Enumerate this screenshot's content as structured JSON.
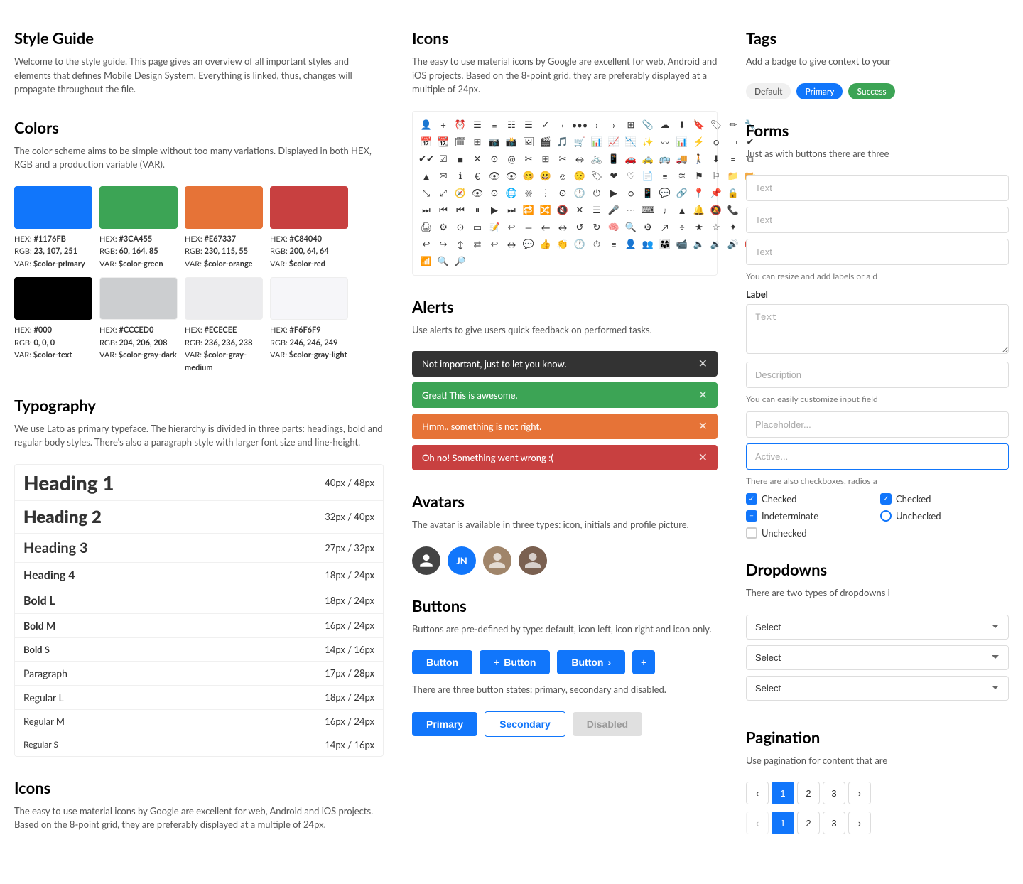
{
  "left": {
    "style_guide": {
      "title": "Style Guide",
      "desc": "Welcome to the style guide. This page gives an overview of all important styles and elements that defines Mobile Design System. Everything is linked, thus, changes will propagate throughout the file."
    },
    "colors": {
      "title": "Colors",
      "desc": "The color scheme aims to be simple without too many variations. Displayed in both HEX, RGB and a production variable (VAR).",
      "swatches": [
        {
          "hex": "#1176FB",
          "rgb": "23, 107, 251",
          "var": "$color-primary",
          "bg": "#1176FB"
        },
        {
          "hex": "#3CA455",
          "rgb": "60, 164, 85",
          "var": "$color-green",
          "bg": "#3CA455"
        },
        {
          "hex": "#E67337",
          "rgb": "230, 115, 55",
          "var": "$color-orange",
          "bg": "#E67337"
        },
        {
          "hex": "#C84040",
          "rgb": "200, 64, 64",
          "var": "$color-red",
          "bg": "#C84040"
        }
      ],
      "swatches2": [
        {
          "hex": "#000",
          "rgb": "0, 0, 0",
          "var": "$color-text",
          "bg": "#000000"
        },
        {
          "hex": "#CCCED0",
          "rgb": "204, 206, 208",
          "var": "$color-gray-dark",
          "bg": "#CCCED0"
        },
        {
          "hex": "#ECECEE",
          "rgb": "236, 236, 238",
          "var": "$color-gray-medium",
          "bg": "#ECECEE"
        },
        {
          "hex": "#F6F6F9",
          "rgb": "246, 246, 249",
          "var": "$color-gray-light",
          "bg": "#F6F6F9"
        }
      ]
    },
    "typography": {
      "title": "Typography",
      "desc": "We use Lato as primary typeface. The hierarchy is divided in three parts: headings, bold and regular body styles. There's also a paragraph style with larger font size and line-height.",
      "rows": [
        {
          "label": "Heading 1",
          "size": "40px / 48px",
          "style": "h1"
        },
        {
          "label": "Heading 2",
          "size": "32px / 40px",
          "style": "h2"
        },
        {
          "label": "Heading 3",
          "size": "27px / 32px",
          "style": "h3"
        },
        {
          "label": "Heading 4",
          "size": "18px / 24px",
          "style": "h4"
        },
        {
          "label": "Bold L",
          "size": "18px / 24px",
          "style": "bold-l"
        },
        {
          "label": "Bold M",
          "size": "16px / 24px",
          "style": "bold-m"
        },
        {
          "label": "Bold S",
          "size": "14px / 16px",
          "style": "bold-s"
        },
        {
          "label": "Paragraph",
          "size": "17px / 28px",
          "style": "para"
        },
        {
          "label": "Regular L",
          "size": "18px / 24px",
          "style": "reg-l"
        },
        {
          "label": "Regular M",
          "size": "16px / 24px",
          "style": "reg-m"
        },
        {
          "label": "Regular S",
          "size": "14px / 16px",
          "style": "reg-s"
        }
      ]
    },
    "icons": {
      "title": "Icons",
      "desc": "The easy to use material icons by Google are excellent for web, Android and iOS projects. Based on the 8-point grid, they are preferably displayed at a multiple of 24px."
    }
  },
  "middle": {
    "icons": {
      "title": "Icons",
      "desc": "The easy to use material icons by Google are excellent for web, Android and iOS projects. Based on the 8-point grid, they are preferably displayed at a multiple of 24px."
    },
    "alerts": {
      "title": "Alerts",
      "desc": "Use alerts to give users quick feedback on performed tasks.",
      "items": [
        {
          "text": "Not important, just to let you know.",
          "type": "dark"
        },
        {
          "text": "Great! This is awesome.",
          "type": "green"
        },
        {
          "text": "Hmm.. something is not right.",
          "type": "orange"
        },
        {
          "text": "Oh no! Something went wrong :(",
          "type": "red"
        }
      ]
    },
    "avatars": {
      "title": "Avatars",
      "desc": "The avatar is available in three types: icon, initials and profile picture.",
      "initials": "JN"
    },
    "buttons": {
      "title": "Buttons",
      "desc": "Buttons are pre-defined by type: default, icon left, icon right and icon only.",
      "desc2": "There are three button states: primary, secondary and disabled.",
      "labels": {
        "button": "Button",
        "primary": "Primary",
        "secondary": "Secondary",
        "disabled": "Disabled"
      }
    }
  },
  "right": {
    "tags": {
      "title": "Tags",
      "desc": "Add a badge to give context to your",
      "items": [
        {
          "label": "Default",
          "type": "default"
        },
        {
          "label": "Primary",
          "type": "primary"
        },
        {
          "label": "Success",
          "type": "success"
        }
      ]
    },
    "forms": {
      "title": "Forms",
      "desc": "Just as with buttons there are three",
      "inputs": [
        {
          "placeholder": "Text",
          "type": "normal"
        },
        {
          "placeholder": "Text",
          "type": "normal"
        },
        {
          "placeholder": "Text",
          "type": "normal"
        }
      ],
      "textarea_desc": "You can resize and add labels or a d",
      "label": "Label",
      "textarea_placeholder": "Text",
      "field_desc": "Description",
      "input_desc": "You can easily customize input field",
      "placeholder_input": "Placeholder...",
      "active_input": "Active...",
      "checkbox_desc": "There are also checkboxes, radios a",
      "checkboxes": [
        {
          "label": "Checked",
          "state": "checked-blue"
        },
        {
          "label": "Checked",
          "state": "checked-dark"
        },
        {
          "label": "Indeterminate",
          "state": "indeterminate"
        },
        {
          "label": "Unchecked",
          "state": "unchecked-radio"
        },
        {
          "label": "Unchecked",
          "state": "unchecked"
        }
      ]
    },
    "dropdowns": {
      "title": "Dropdowns",
      "desc": "There are two types of dropdowns i",
      "options": [
        "Select",
        "Select",
        "Select"
      ]
    },
    "pagination": {
      "title": "Pagination",
      "desc": "Use pagination for content that are",
      "pages1": [
        "<",
        "1",
        "2",
        "3",
        ">"
      ],
      "pages2": [
        "<",
        "1",
        "2",
        "3",
        ">"
      ]
    }
  }
}
